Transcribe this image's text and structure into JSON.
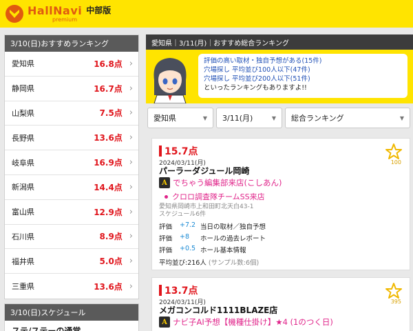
{
  "header": {
    "logo_name": "HallNavi",
    "logo_sub": "premium",
    "region": "中部版"
  },
  "left": {
    "title": "3/10(日)おすすめランキング",
    "rows": [
      {
        "name": "愛知県",
        "score": "16.8点"
      },
      {
        "name": "静岡県",
        "score": "16.7点"
      },
      {
        "name": "山梨県",
        "score": "7.5点"
      },
      {
        "name": "長野県",
        "score": "13.6点"
      },
      {
        "name": "岐阜県",
        "score": "16.9点"
      },
      {
        "name": "新潟県",
        "score": "14.4点"
      },
      {
        "name": "富山県",
        "score": "12.9点"
      },
      {
        "name": "石川県",
        "score": "8.9点"
      },
      {
        "name": "福井県",
        "score": "5.0点"
      },
      {
        "name": "三重県",
        "score": "13.6点"
      }
    ],
    "chevron": "›",
    "schedule_title": "3/10(日)スケジュール",
    "schedule_cut": "ステ/ステーの通常"
  },
  "right": {
    "title": "愛知県｜3/11(月)｜おすすめ総合ランキング",
    "bubble": {
      "line1": "評価の高い取材・独自予想がある(15件)",
      "line2": "穴場探し 平均並び100人以下(47件)",
      "line3": "穴場探し 平均並び200人以下(51件)",
      "line4": "といったランキングもありますよ!!"
    },
    "filters": {
      "pref": "愛知県",
      "date": "3/11(月)",
      "kind": "総合ランキング"
    },
    "cards": [
      {
        "score": "15.7点",
        "date": "2024/03/11(月)",
        "hall": "パーラーダジュール岡崎",
        "fav": "100",
        "event_main": "でちゃう編集部来店(こしあん)",
        "event_sub": "クロロ調査隊チームSS来店",
        "addr": "愛知県岡崎市上和田町北天白43-1",
        "sched": "スケジュール6件",
        "evals": [
          {
            "label": "評価",
            "num": "+7.2",
            "text": "当日の取材／独自予想"
          },
          {
            "label": "評価",
            "num": "+8",
            "text": "ホールの過去レポート"
          },
          {
            "label": "評価",
            "num": "+0.5",
            "text": "ホール基本情報"
          }
        ],
        "avg": "平均並び:216人",
        "sample": "(サンプル数:6個)"
      },
      {
        "score": "13.7点",
        "date": "2024/03/11(月)",
        "hall": "メガコンコルド1111BLAZE店",
        "fav": "395",
        "event_main": "ナビ子AI予想【機種仕掛け】★4 (1のつく日)"
      }
    ]
  },
  "colors": {
    "brand_yellow": "#ffe400",
    "score_red": "#e0141b",
    "event_pink": "#e0248a",
    "eval_blue": "#1a8ad4"
  },
  "icons": {
    "logo": "hallnavi-logo-icon",
    "star": "star-icon",
    "chevron": "chevron-right-icon",
    "dropdown": "dropdown-triangle-icon",
    "badge": "a-badge-icon"
  }
}
